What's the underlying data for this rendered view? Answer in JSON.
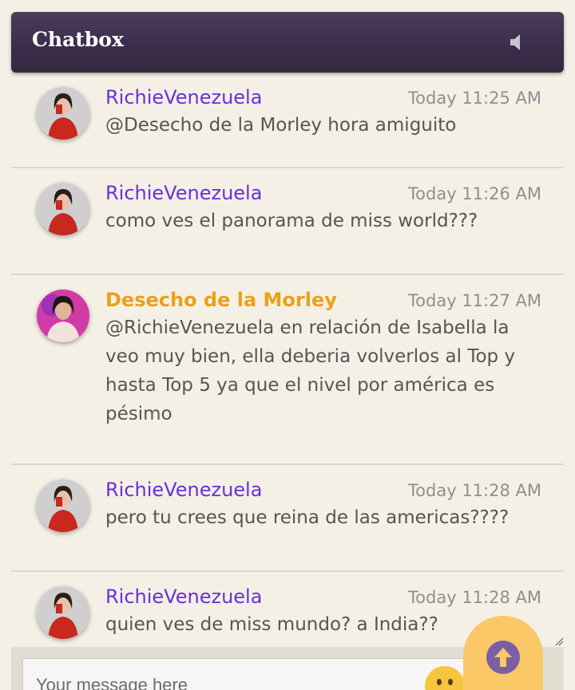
{
  "header": {
    "title": "Chatbox",
    "sound_icon": "speaker-icon"
  },
  "messages": [
    {
      "user": "RichieVenezuela",
      "user_color": "#6a30d9",
      "time": "Today 11:25 AM",
      "text": "@Desecho de la Morley hora amiguito",
      "avatar": "avatar-red-dress"
    },
    {
      "user": "RichieVenezuela",
      "user_color": "#6a30d9",
      "time": "Today 11:26 AM",
      "text": "como ves el panorama de miss world???",
      "avatar": "avatar-red-dress"
    },
    {
      "user": "Desecho de la Morley",
      "user_color": "#e8a11a",
      "time": "Today 11:27 AM",
      "text": "@RichieVenezuela en relación de Isabella la veo muy bien, ella deberia volverlos al Top y hasta Top 5 ya que el nivel por américa es pésimo",
      "avatar": "avatar-pink"
    },
    {
      "user": "RichieVenezuela",
      "user_color": "#6a30d9",
      "time": "Today 11:28 AM",
      "text": "pero tu crees que reina de las americas????",
      "avatar": "avatar-red-dress"
    },
    {
      "user": "RichieVenezuela",
      "user_color": "#6a30d9",
      "time": "Today 11:28 AM",
      "text": "quien ves de miss mundo? a India??",
      "avatar": "avatar-red-dress"
    }
  ],
  "composer": {
    "placeholder": "Your message here",
    "emoji_icon": "emoji-icon",
    "scroll_icon": "arrow-up-circle-icon"
  }
}
